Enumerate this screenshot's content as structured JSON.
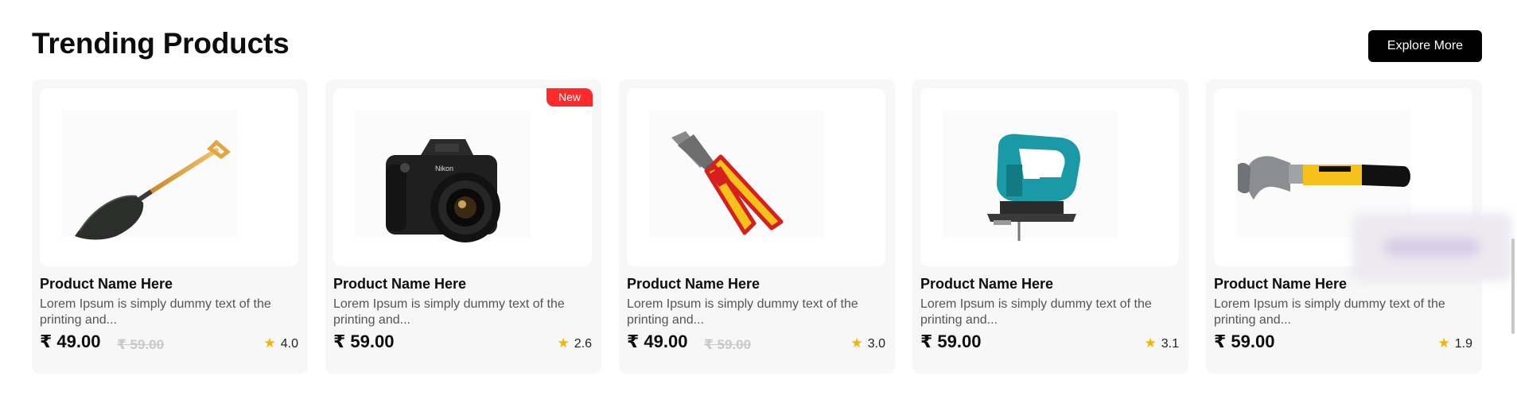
{
  "section": {
    "title": "Trending Products",
    "explore_label": "Explore More"
  },
  "products": [
    {
      "name": "Product Name Here",
      "description": "Lorem Ipsum is simply dummy text of the printing and...",
      "price": "₹ 49.00",
      "old_price": "₹ 59.00",
      "rating": "4.0",
      "badge": "",
      "image": "shovel-image"
    },
    {
      "name": "Product Name Here",
      "description": "Lorem Ipsum is simply dummy text of the printing and...",
      "price": "₹ 59.00",
      "old_price": "",
      "rating": "2.6",
      "badge": "New",
      "image": "camera-image"
    },
    {
      "name": "Product Name Here",
      "description": "Lorem Ipsum is simply dummy text of the printing and...",
      "price": "₹ 49.00",
      "old_price": "₹ 59.00",
      "rating": "3.0",
      "badge": "",
      "image": "pliers-image"
    },
    {
      "name": "Product Name Here",
      "description": "Lorem Ipsum is simply dummy text of the printing and...",
      "price": "₹ 59.00",
      "old_price": "",
      "rating": "3.1",
      "badge": "",
      "image": "jigsaw-image"
    },
    {
      "name": "Product Name Here",
      "description": "Lorem Ipsum is simply dummy text of the printing and...",
      "price": "₹ 59.00",
      "old_price": "",
      "rating": "1.9",
      "badge": "",
      "image": "hammer-image"
    }
  ],
  "icons": {
    "rating": "star-icon"
  },
  "colors": {
    "badge": "#ff2a2a",
    "star": "#f5b400",
    "button_bg": "#000000",
    "card_bg": "#f7f7f7"
  }
}
